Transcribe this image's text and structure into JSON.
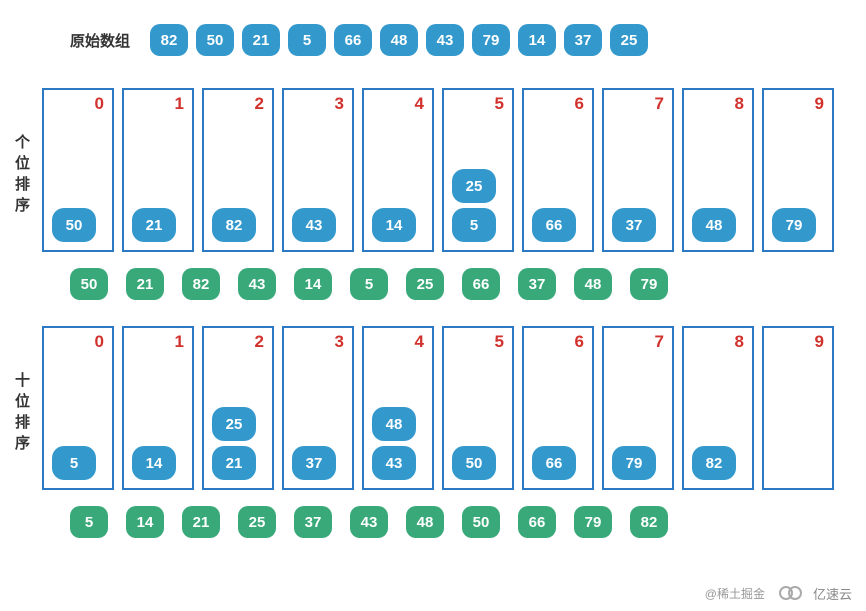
{
  "original": {
    "label": "原始数组",
    "values": [
      82,
      50,
      21,
      5,
      66,
      48,
      43,
      79,
      14,
      37,
      25
    ]
  },
  "ones_sort": {
    "label": "个位排序",
    "buckets": [
      {
        "label": "0",
        "items": [
          50
        ]
      },
      {
        "label": "1",
        "items": [
          21
        ]
      },
      {
        "label": "2",
        "items": [
          82
        ]
      },
      {
        "label": "3",
        "items": [
          43
        ]
      },
      {
        "label": "4",
        "items": [
          14
        ]
      },
      {
        "label": "5",
        "items": [
          25,
          5
        ]
      },
      {
        "label": "6",
        "items": [
          66
        ]
      },
      {
        "label": "7",
        "items": [
          37
        ]
      },
      {
        "label": "8",
        "items": [
          48
        ]
      },
      {
        "label": "9",
        "items": [
          79
        ]
      }
    ],
    "result": [
      50,
      21,
      82,
      43,
      14,
      5,
      25,
      66,
      37,
      48,
      79
    ]
  },
  "tens_sort": {
    "label": "十位排序",
    "buckets": [
      {
        "label": "0",
        "items": [
          5
        ]
      },
      {
        "label": "1",
        "items": [
          14
        ]
      },
      {
        "label": "2",
        "items": [
          25,
          21
        ]
      },
      {
        "label": "3",
        "items": [
          37
        ]
      },
      {
        "label": "4",
        "items": [
          48,
          43
        ]
      },
      {
        "label": "5",
        "items": [
          50
        ]
      },
      {
        "label": "6",
        "items": [
          66
        ]
      },
      {
        "label": "7",
        "items": [
          79
        ]
      },
      {
        "label": "8",
        "items": [
          82
        ]
      },
      {
        "label": "9",
        "items": []
      }
    ],
    "result": [
      5,
      14,
      21,
      25,
      37,
      43,
      48,
      50,
      66,
      79,
      82
    ]
  },
  "watermark": {
    "left": "@稀土掘金",
    "right": "亿速云"
  }
}
